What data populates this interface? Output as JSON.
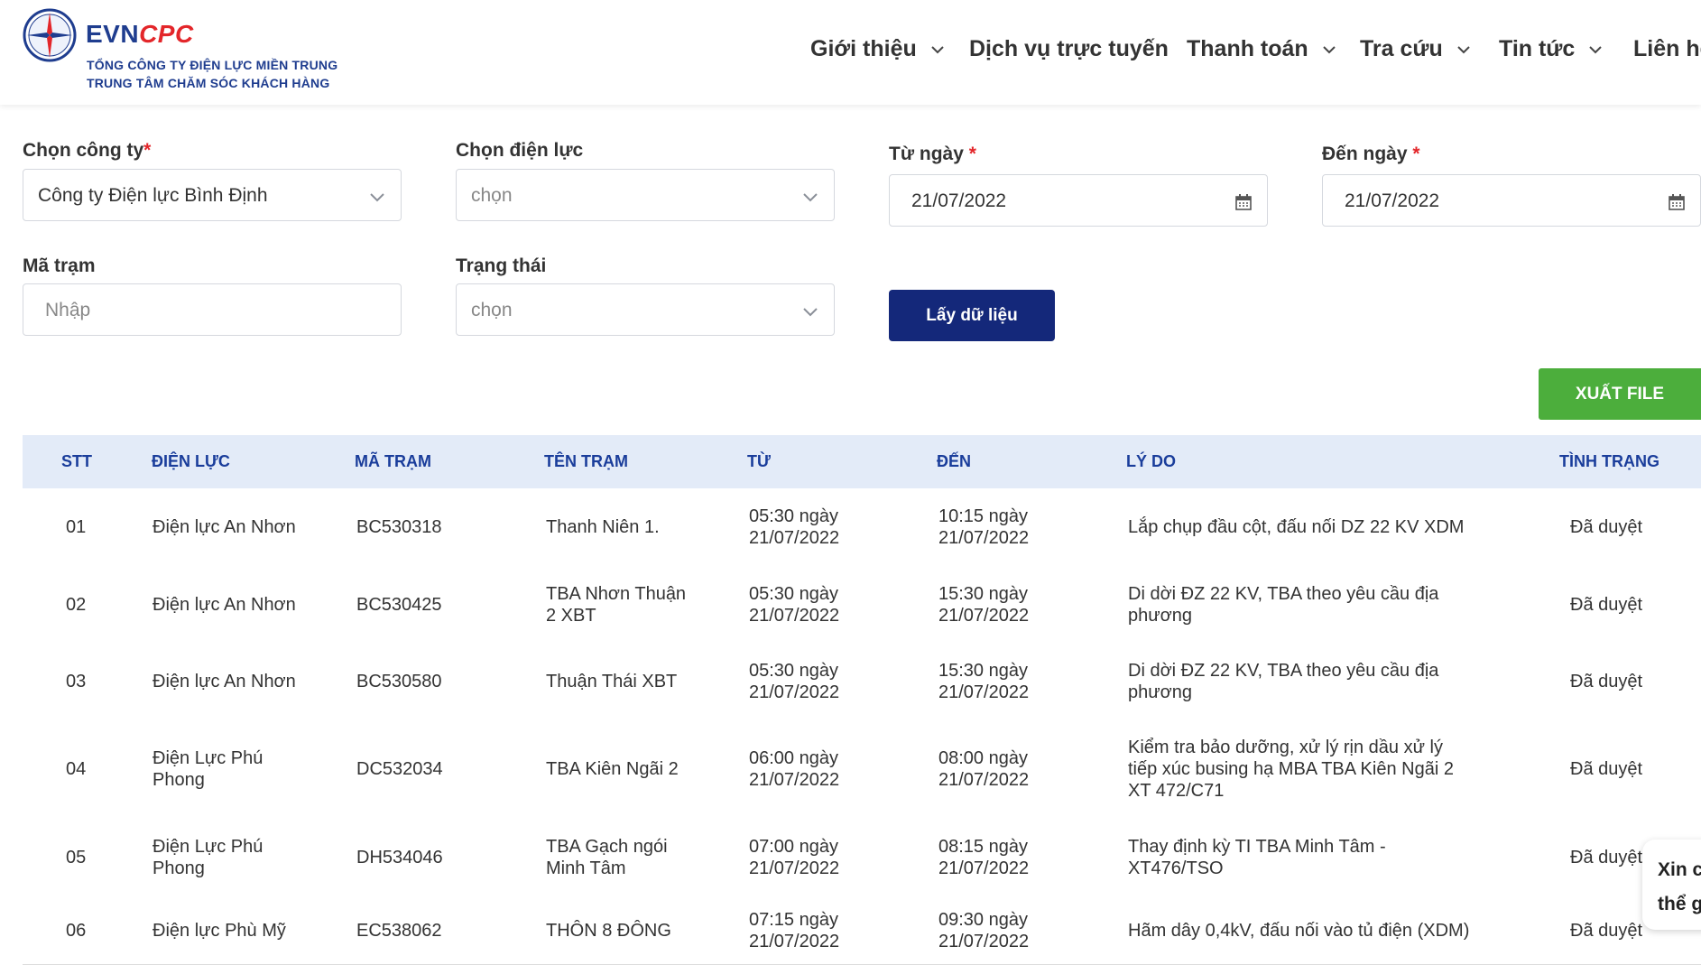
{
  "header": {
    "brand_evn": "EVN",
    "brand_cpc": "CPC",
    "subtitle1": "TỔNG CÔNG TY ĐIỆN LỰC MIỀN TRUNG",
    "subtitle2": "TRUNG TÂM CHĂM SÓC KHÁCH HÀNG",
    "nav": [
      {
        "label": "Giới thiệu",
        "dropdown": true
      },
      {
        "label": "Dịch vụ trực tuyến",
        "dropdown": false
      },
      {
        "label": "Thanh toán",
        "dropdown": true
      },
      {
        "label": "Tra cứu",
        "dropdown": true
      },
      {
        "label": "Tin tức",
        "dropdown": true
      },
      {
        "label": "Liên hệ",
        "dropdown": false
      }
    ]
  },
  "form": {
    "company": {
      "label": "Chọn công ty",
      "required_mark": "*",
      "value": "Công ty Điện lực Bình Định"
    },
    "power": {
      "label": "Chọn điện lực",
      "placeholder": "chọn"
    },
    "from_date": {
      "label": "Từ ngày",
      "required_mark": "*",
      "value": "21/07/2022"
    },
    "to_date": {
      "label": "Đến ngày",
      "required_mark": "*",
      "value": "21/07/2022"
    },
    "station_code": {
      "label": "Mã trạm",
      "placeholder": "Nhập"
    },
    "status": {
      "label": "Trạng thái",
      "placeholder": "chọn"
    },
    "fetch_button": "Lấy dữ liệu",
    "export_button": "XUẤT FILE"
  },
  "table": {
    "headers": [
      "STT",
      "ĐIỆN LỰC",
      "MÃ TRẠM",
      "TÊN TRẠM",
      "TỪ",
      "ĐẾN",
      "LÝ DO",
      "TÌNH TRẠNG"
    ],
    "rows": [
      {
        "stt": "01",
        "dienluc": [
          "Điện lực An Nhơn"
        ],
        "ma": "BC530318",
        "ten": [
          "Thanh Niên 1."
        ],
        "tu": [
          "05:30 ngày",
          "21/07/2022"
        ],
        "den": [
          "10:15 ngày",
          "21/07/2022"
        ],
        "lydo": [
          "Lắp chụp đầu cột, đấu nối DZ 22 KV XDM"
        ],
        "tinhtrang": "Đã duyệt"
      },
      {
        "stt": "02",
        "dienluc": [
          "Điện lực An Nhơn"
        ],
        "ma": "BC530425",
        "ten": [
          "TBA Nhơn Thuận",
          "2 XBT"
        ],
        "tu": [
          "05:30 ngày",
          "21/07/2022"
        ],
        "den": [
          "15:30 ngày",
          "21/07/2022"
        ],
        "lydo": [
          "Di dời ĐZ 22 KV, TBA theo yêu cầu địa",
          "phương"
        ],
        "tinhtrang": "Đã duyệt"
      },
      {
        "stt": "03",
        "dienluc": [
          "Điện lực An Nhơn"
        ],
        "ma": "BC530580",
        "ten": [
          "Thuận Thái XBT"
        ],
        "tu": [
          "05:30 ngày",
          "21/07/2022"
        ],
        "den": [
          "15:30 ngày",
          "21/07/2022"
        ],
        "lydo": [
          "Di dời ĐZ 22 KV, TBA theo yêu cầu địa",
          "phương"
        ],
        "tinhtrang": "Đã duyệt"
      },
      {
        "stt": "04",
        "dienluc": [
          "Điện Lực Phú",
          "Phong"
        ],
        "ma": "DC532034",
        "ten": [
          "TBA Kiên Ngãi 2"
        ],
        "tu": [
          "06:00 ngày",
          "21/07/2022"
        ],
        "den": [
          "08:00 ngày",
          "21/07/2022"
        ],
        "lydo": [
          "Kiểm tra bảo dưỡng, xử lý rịn dầu xử lý",
          "tiếp xúc busing hạ MBA TBA Kiên Ngãi 2",
          "XT 472/C71"
        ],
        "tinhtrang": "Đã duyệt"
      },
      {
        "stt": "05",
        "dienluc": [
          "Điện Lực Phú",
          "Phong"
        ],
        "ma": "DH534046",
        "ten": [
          "TBA Gạch ngói",
          "Minh Tâm"
        ],
        "tu": [
          "07:00 ngày",
          "21/07/2022"
        ],
        "den": [
          "08:15 ngày",
          "21/07/2022"
        ],
        "lydo": [
          "Thay định kỳ TI TBA Minh Tâm -",
          "XT476/TSO"
        ],
        "tinhtrang": "Đã duyệt"
      },
      {
        "stt": "06",
        "dienluc": [
          "Điện lực Phù Mỹ"
        ],
        "ma": "EC538062",
        "ten": [
          "THÔN 8 ĐÔNG"
        ],
        "tu": [
          "07:15 ngày",
          "21/07/2022"
        ],
        "den": [
          "09:30 ngày",
          "21/07/2022"
        ],
        "lydo": [
          "Hãm dây 0,4kV, đấu nối vào tủ điện (XDM)"
        ],
        "tinhtrang": "Đã duyệt"
      }
    ]
  },
  "chat": {
    "line1": "Xin c",
    "line2": "thể g"
  },
  "colors": {
    "brand_blue": "#14287a",
    "brand_red": "#e3262a",
    "export_green": "#4cae3c",
    "header_bg": "#e3ebf8",
    "header_text": "#1a3d9b"
  }
}
